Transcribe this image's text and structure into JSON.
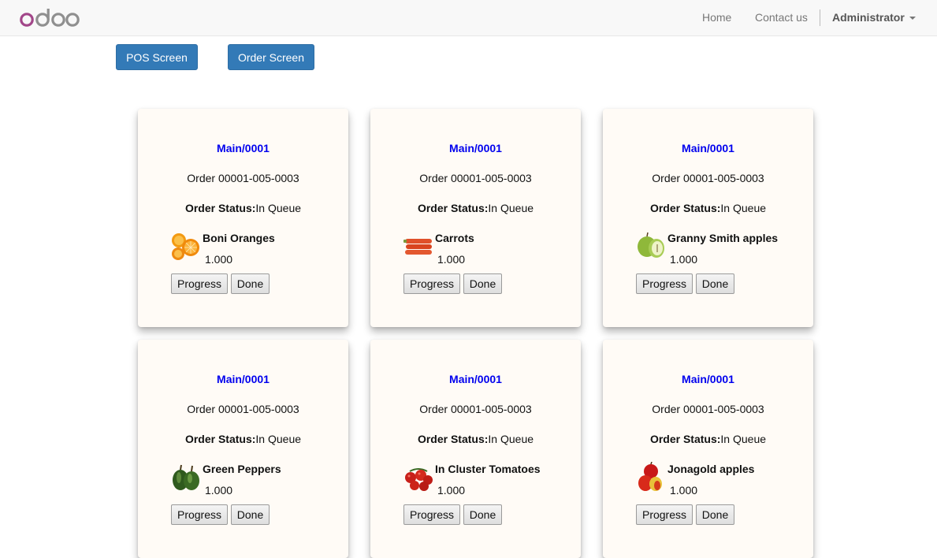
{
  "navbar": {
    "brand": "odoo",
    "links": [
      "Home",
      "Contact us"
    ],
    "user": "Administrator"
  },
  "buttons": {
    "pos_screen": "POS Screen",
    "order_screen": "Order Screen"
  },
  "labels": {
    "status_label": "Order Status:",
    "progress": "Progress",
    "done": "Done"
  },
  "cards": [
    {
      "title": "Main/0001",
      "order": "Order 00001-005-0003",
      "status": "In Queue",
      "product": "Boni Oranges",
      "qty": "1.000",
      "icon": "orange-icon"
    },
    {
      "title": "Main/0001",
      "order": "Order 00001-005-0003",
      "status": "In Queue",
      "product": "Carrots",
      "qty": "1.000",
      "icon": "carrot-icon"
    },
    {
      "title": "Main/0001",
      "order": "Order 00001-005-0003",
      "status": "In Queue",
      "product": "Granny Smith apples",
      "qty": "1.000",
      "icon": "green-apple-icon"
    },
    {
      "title": "Main/0001",
      "order": "Order 00001-005-0003",
      "status": "In Queue",
      "product": "Green Peppers",
      "qty": "1.000",
      "icon": "green-pepper-icon"
    },
    {
      "title": "Main/0001",
      "order": "Order 00001-005-0003",
      "status": "In Queue",
      "product": "In Cluster Tomatoes",
      "qty": "1.000",
      "icon": "tomato-icon"
    },
    {
      "title": "Main/0001",
      "order": "Order 00001-005-0003",
      "status": "In Queue",
      "product": "Jonagold apples",
      "qty": "1.000",
      "icon": "red-apple-icon"
    }
  ],
  "colors": {
    "primary": "#337ab7",
    "link": "#0000ee",
    "card_bg": "#fffbf6",
    "logo_purple": "#a24689",
    "logo_gray": "#8f8f8f"
  }
}
